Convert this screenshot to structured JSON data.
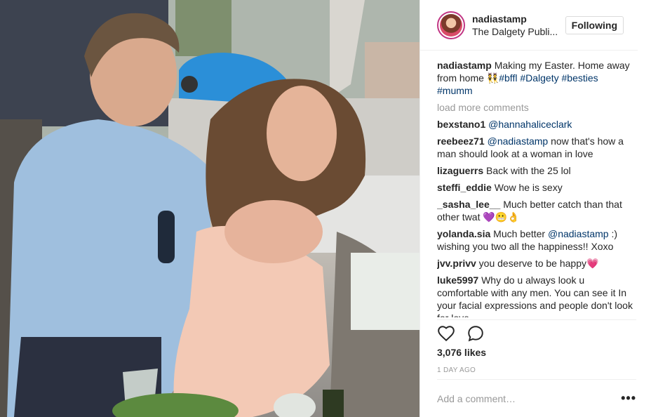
{
  "post": {
    "username": "nadiastamp",
    "location": "The Dalgety Publi...",
    "follow_label": "Following"
  },
  "caption": {
    "username": "nadiastamp",
    "text": "Making my Easter. Home away from home 👯",
    "tags": [
      "#bffl",
      "#Dalgety",
      "#besties",
      "#mumm"
    ]
  },
  "load_more_label": "load more comments",
  "comments": [
    {
      "user": "bexstano1",
      "mention": "@hannahaliceclark",
      "text": ""
    },
    {
      "user": "reebeez71",
      "mention": "@nadiastamp",
      "text": "now that's how a man should look at a woman in love"
    },
    {
      "user": "lizaguerrs",
      "mention": "",
      "text": "Back with the 25 lol"
    },
    {
      "user": "steffi_eddie",
      "mention": "",
      "text": "Wow he is sexy"
    },
    {
      "user": "_sasha_lee__",
      "mention": "",
      "text": "Much better catch than that other twat 💜😬👌"
    },
    {
      "user": "yolanda.sia",
      "mention": "",
      "text": "Much better"
    },
    {
      "user": "jvv.privv",
      "mention": "",
      "text": "you deserve to be happy💗"
    },
    {
      "user": "luke5997",
      "mention": "",
      "text": "Why do u always look u comfortable with any men. You can see it In your facial expressions and people don't look for love"
    }
  ],
  "yolanda_mention": "@nadiastamp",
  "yolanda_tail": ":) wishing you two all the happiness!! Xoxo",
  "likes": "3,076 likes",
  "time": "1 DAY AGO",
  "add_comment_placeholder": "Add a comment…",
  "more_label": "•••",
  "icons": {
    "like": "heart-icon",
    "comment": "comment-bubble-icon",
    "more": "more-options-icon"
  }
}
